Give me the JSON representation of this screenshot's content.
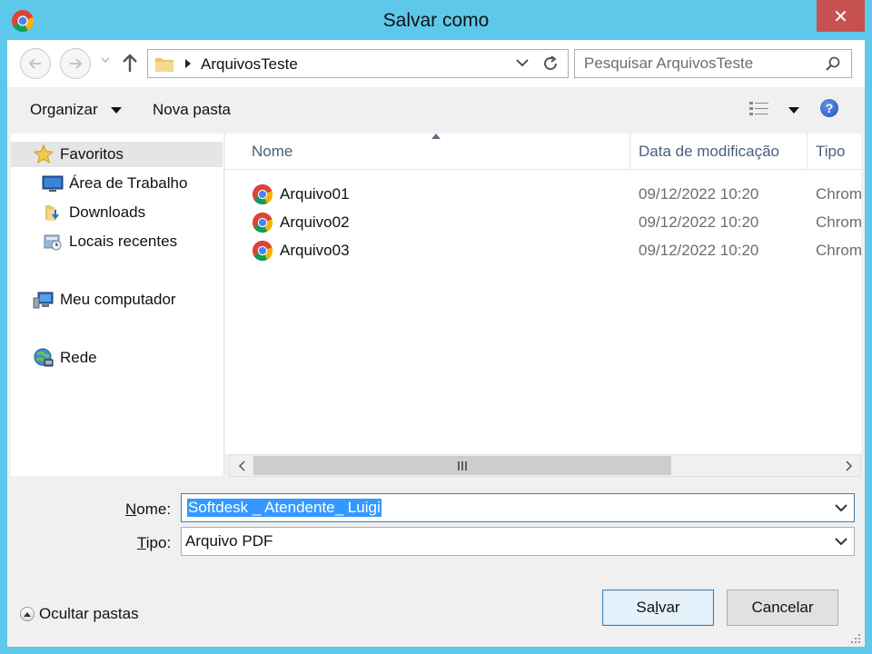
{
  "window": {
    "title": "Salvar como",
    "close_symbol": "✕"
  },
  "address": {
    "path": "ArquivosTeste",
    "search_placeholder": "Pesquisar ArquivosTeste"
  },
  "toolbar": {
    "organize_label": "Organizar",
    "new_folder_label": "Nova pasta",
    "help_label": "?"
  },
  "nav_pane": {
    "items": [
      {
        "label": "Favoritos",
        "icon": "star-icon"
      },
      {
        "label": "Área de Trabalho",
        "icon": "desktop-icon"
      },
      {
        "label": "Downloads",
        "icon": "downloads-folder-icon"
      },
      {
        "label": "Locais recentes",
        "icon": "recent-places-icon"
      },
      {
        "label": "Meu computador",
        "icon": "computer-icon"
      },
      {
        "label": "Rede",
        "icon": "network-icon"
      }
    ]
  },
  "file_list": {
    "columns": [
      "Nome",
      "Data de modificação",
      "Tipo"
    ],
    "rows": [
      {
        "name": "Arquivo01",
        "date": "09/12/2022 10:20",
        "type": "Chrome"
      },
      {
        "name": "Arquivo02",
        "date": "09/12/2022 10:20",
        "type": "Chrome"
      },
      {
        "name": "Arquivo03",
        "date": "09/12/2022 10:20",
        "type": "Chrome"
      }
    ]
  },
  "form": {
    "name_label_prefix": "N",
    "name_label_rest": "ome:",
    "name_value": "Softdesk _ Atendente_ Luigi",
    "type_label_prefix": "T",
    "type_label_rest": "ipo:",
    "type_value": "Arquivo PDF"
  },
  "footer": {
    "hide_folders_label": "Ocultar pastas",
    "save_label_prefix": "Sa",
    "save_label_accel": "l",
    "save_label_rest": "var",
    "cancel_label": "Cancelar"
  },
  "colors": {
    "frame": "#5ec8ea",
    "close": "#c75050",
    "selection": "#3399ff",
    "column_header_text": "#4c607a"
  }
}
